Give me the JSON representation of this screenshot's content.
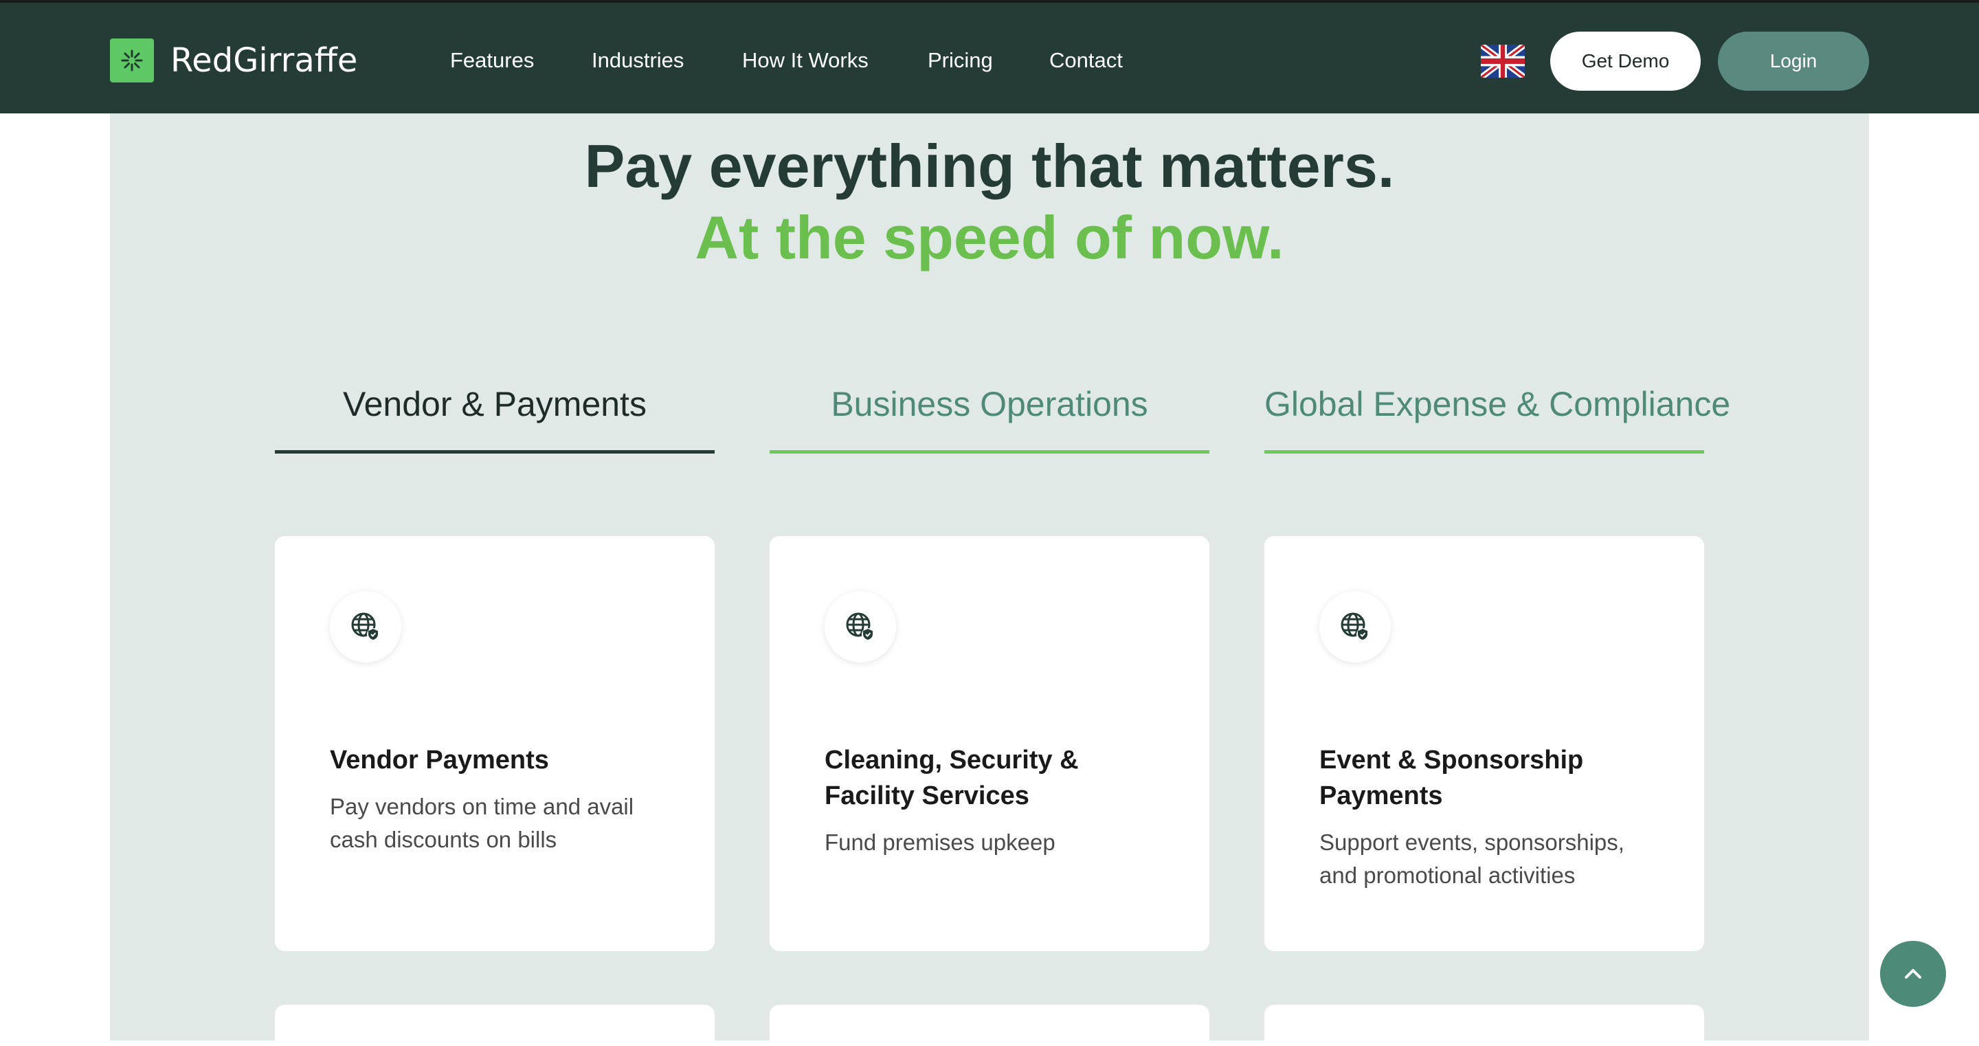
{
  "header": {
    "brand": "RedGirraffe",
    "nav": [
      "Features",
      "Industries",
      "How It Works",
      "Pricing",
      "Contact"
    ],
    "language_icon": "uk-flag-icon",
    "get_demo_label": "Get Demo",
    "login_label": "Login"
  },
  "hero": {
    "title": "Pay everything that matters.",
    "subtitle": "At the speed of now."
  },
  "tabs": [
    {
      "label": "Vendor & Payments",
      "active": true
    },
    {
      "label": "Business Operations",
      "active": false
    },
    {
      "label": "Global Expense & Compliance",
      "active": false
    }
  ],
  "cards": [
    {
      "icon": "globe-shield-icon",
      "title": "Vendor Payments",
      "description": "Pay vendors on time and avail cash discounts on bills"
    },
    {
      "icon": "globe-shield-icon",
      "title": "Cleaning, Security & Facility Services",
      "description": "Fund premises upkeep"
    },
    {
      "icon": "globe-shield-icon",
      "title": "Event & Sponsorship Payments",
      "description": "Support events, sponsorships, and promotional activities"
    }
  ],
  "colors": {
    "navbar": "#253b36",
    "accent_green": "#6bbf4e",
    "panel": "#e1e9e6",
    "login_button": "#5a8a7d"
  },
  "scroll_top_icon": "chevron-up-icon"
}
